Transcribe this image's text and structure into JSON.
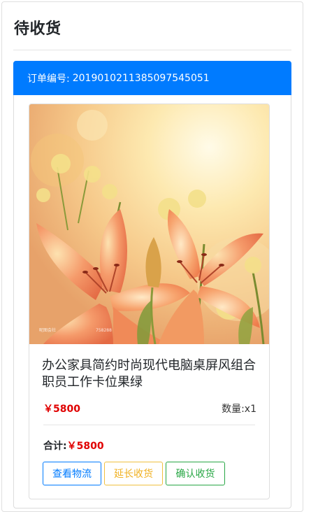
{
  "page": {
    "title": "待收货"
  },
  "order": {
    "header_label": "订单编号:",
    "order_number": "201901021138509754505 1"
  },
  "product": {
    "name": "办公家具简约时尚现代电脑桌屏风组合职员工作卡位果绿",
    "price": "￥5800",
    "quantity": "数量:x1",
    "image_watermark": "昵图会社",
    "image_watermark_id": "758288"
  },
  "summary": {
    "total_label": "合计:",
    "total_amount": "￥5800"
  },
  "actions": {
    "view_logistics": "查看物流",
    "extend_receipt": "延长收货",
    "confirm_receipt": "确认收货"
  },
  "colors": {
    "primary": "#007bff",
    "price_red": "#e00000",
    "warning": "#f0b020",
    "success": "#28a745"
  }
}
